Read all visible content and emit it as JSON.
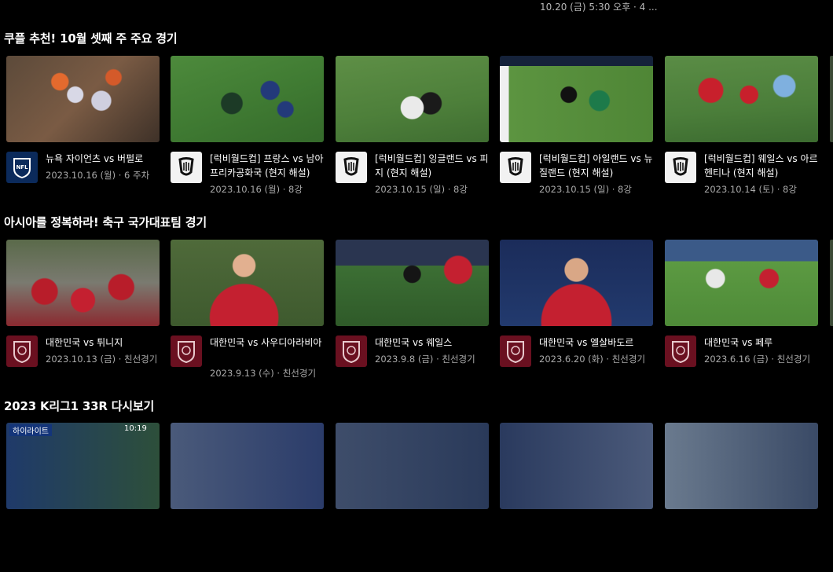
{
  "top_meta": "10.20 (금) 5:30 오후 · 4 ...",
  "sections": [
    {
      "title": "쿠플 추천! 10월 셋째 주 주요 경기",
      "cards": [
        {
          "title": "뉴욕 자이언츠 vs 버펄로",
          "meta": "2023.10.16 (월) · 6 주차",
          "logo": "nfl-logo"
        },
        {
          "title": "[럭비월드컵] 프랑스 vs 남아프리카공화국 (현지 해설)",
          "meta": "2023.10.16 (월) · 8강",
          "logo": "rugby-world-cup-logo"
        },
        {
          "title": "[럭비월드컵] 잉글랜드 vs 피지 (현지 해설)",
          "meta": "2023.10.15 (일) · 8강",
          "logo": "rugby-world-cup-logo"
        },
        {
          "title": "[럭비월드컵] 아일랜드 vs 뉴질랜드 (현지 해설)",
          "meta": "2023.10.15 (일) · 8강",
          "logo": "rugby-world-cup-logo"
        },
        {
          "title": "[럭비월드컵] 웨일스 vs 아르헨티나 (현지 해설)",
          "meta": "2023.10.14 (토) · 8강",
          "logo": "rugby-world-cup-logo"
        }
      ]
    },
    {
      "title": "아시아를 정복하라! 축구 국가대표팀 경기",
      "cards": [
        {
          "title": "대한민국 vs 튀니지",
          "meta": "2023.10.13 (금) · 친선경기",
          "logo": "kfa-logo"
        },
        {
          "title": "대한민국 vs 사우디아라비아",
          "meta": "2023.9.13 (수) · 친선경기",
          "logo": "kfa-logo"
        },
        {
          "title": "대한민국 vs 웨일스",
          "meta": "2023.9.8 (금) · 친선경기",
          "logo": "kfa-logo"
        },
        {
          "title": "대한민국 vs 엘살바도르",
          "meta": "2023.6.20 (화) · 친선경기",
          "logo": "kfa-logo"
        },
        {
          "title": "대한민국 vs 페루",
          "meta": "2023.6.16 (금) · 친선경기",
          "logo": "kfa-logo"
        }
      ]
    },
    {
      "title": "2023 K리그1 33R 다시보기",
      "cards": [
        {
          "badge": "하이라이트",
          "score": "10:19"
        },
        {},
        {},
        {},
        {}
      ]
    }
  ],
  "colors": {
    "background": "#000000",
    "meta_text": "#a9a9a9",
    "nfl_logo_bg": "#0b2a5b",
    "kfa_logo_bg": "#6a1020"
  }
}
